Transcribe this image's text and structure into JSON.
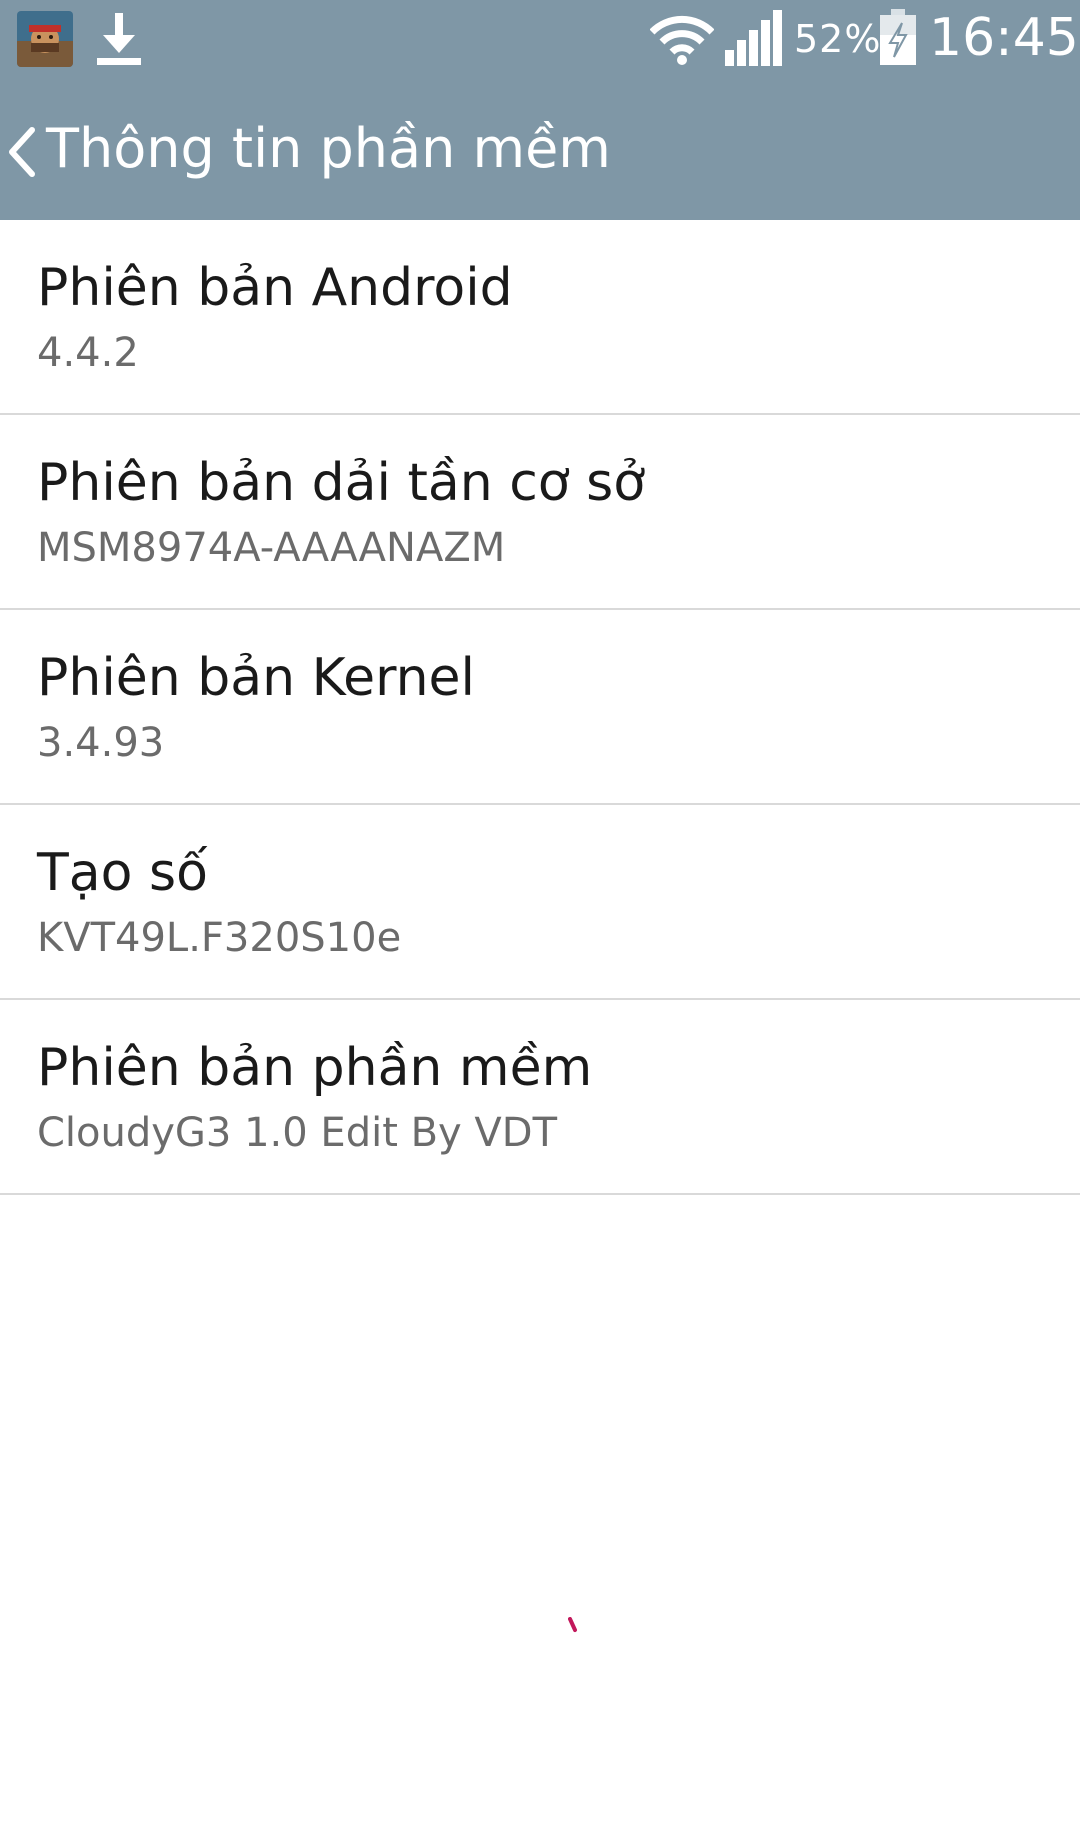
{
  "status_bar": {
    "notification_icons": [
      "game-app-icon",
      "download-icon"
    ],
    "wifi_icon": "wifi-icon",
    "signal_icon": "signal-strength-icon",
    "battery_percent": "52%",
    "battery_icon": "battery-charging-icon",
    "clock": "16:45"
  },
  "action_bar": {
    "back_icon": "chevron-left-icon",
    "title": "Thông tin phần mềm",
    "background_color": "#7f97a6"
  },
  "list": {
    "items": [
      {
        "title": "Phiên bản Android",
        "value": "4.4.2"
      },
      {
        "title": "Phiên bản dải tần cơ sở",
        "value": "MSM8974A-AAAANAZM"
      },
      {
        "title": "Phiên bản Kernel",
        "value": "3.4.93"
      },
      {
        "title": "Tạo số",
        "value": "KVT49L.F320S10e"
      },
      {
        "title": "Phiên bản phần mềm",
        "value": "CloudyG3 1.0 Edit By VDT"
      }
    ]
  }
}
